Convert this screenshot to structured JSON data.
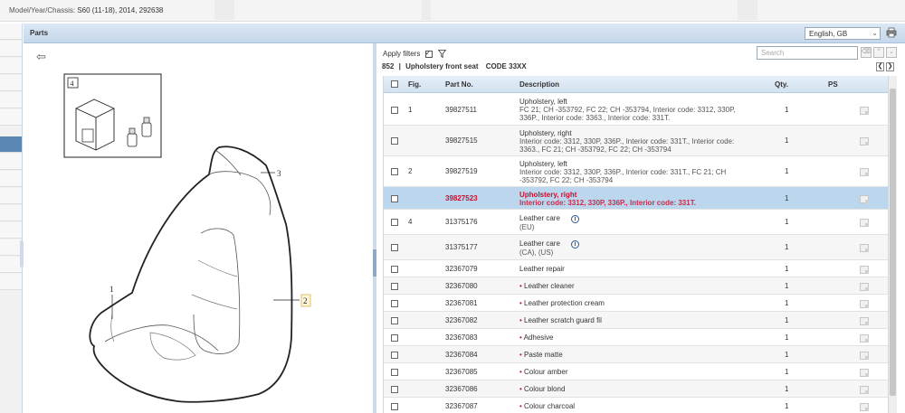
{
  "topbar": {
    "model_label": "Model/Year/Chassis:",
    "model_value": "S60 (11-18), 2014, 292638"
  },
  "parts_panel": {
    "title": "Parts",
    "language": "English, GB",
    "search_placeholder": "Search"
  },
  "toolbar": {
    "apply_filters_label": "Apply filters",
    "apply_filters_checked": true,
    "section_number": "852",
    "separator": "|",
    "section_title": "Upholstery front seat",
    "section_code": "CODE 33XX"
  },
  "illustration": {
    "inset_label": "4",
    "callouts": [
      "1",
      "2",
      "3"
    ]
  },
  "table": {
    "headers": {
      "fig": "Fig.",
      "part_no": "Part No.",
      "description": "Description",
      "qty": "Qty.",
      "ps": "PS"
    },
    "rows": [
      {
        "fig": "1",
        "part_no": "39827511",
        "title": "Upholstery, left",
        "details": [
          "FC 21; CH -353792, FC 22; CH -353794, Interior code: 3312, 330P,",
          "336P., Interior code: 3363., Interior code: 331T."
        ],
        "qty": "1"
      },
      {
        "fig": "",
        "part_no": "39827515",
        "title": "Upholstery, right",
        "details": [
          "Interior code: 3312, 330P, 336P., Interior code: 331T., Interior code:",
          "3363., FC 21; CH -353792, FC 22; CH -353794"
        ],
        "qty": "1"
      },
      {
        "fig": "2",
        "part_no": "39827519",
        "title": "Upholstery, left",
        "details": [
          "Interior code: 3312, 330P, 336P., Interior code: 331T., FC 21; CH",
          "-353792, FC 22; CH -353794"
        ],
        "qty": "1"
      },
      {
        "fig": "",
        "part_no": "39827523",
        "title": "Upholstery, right",
        "details": [
          "Interior code: 3312, 330P, 336P., Interior code: 331T."
        ],
        "qty": "1",
        "selected": true
      },
      {
        "fig": "4",
        "part_no": "31375176",
        "title": "Leather care",
        "details": [
          "(EU)"
        ],
        "qty": "1",
        "info": true
      },
      {
        "fig": "",
        "part_no": "31375177",
        "title": "Leather care",
        "details": [
          "(CA), (US)"
        ],
        "qty": "1",
        "info": true
      },
      {
        "fig": "",
        "part_no": "32367079",
        "title": "Leather repair",
        "details": [],
        "qty": "1"
      },
      {
        "fig": "",
        "part_no": "32367080",
        "title": "Leather cleaner",
        "details": [],
        "qty": "1",
        "bullet": true
      },
      {
        "fig": "",
        "part_no": "32367081",
        "title": "Leather protection cream",
        "details": [],
        "qty": "1",
        "bullet": true
      },
      {
        "fig": "",
        "part_no": "32367082",
        "title": "Leather scratch guard fil",
        "details": [],
        "qty": "1",
        "bullet": true
      },
      {
        "fig": "",
        "part_no": "32367083",
        "title": "Adhesive",
        "details": [],
        "qty": "1",
        "bullet": true
      },
      {
        "fig": "",
        "part_no": "32367084",
        "title": "Paste matte",
        "details": [],
        "qty": "1",
        "bullet": true
      },
      {
        "fig": "",
        "part_no": "32367085",
        "title": "Colour amber",
        "details": [],
        "qty": "1",
        "bullet": true
      },
      {
        "fig": "",
        "part_no": "32367086",
        "title": "Colour blond",
        "details": [],
        "qty": "1",
        "bullet": true
      },
      {
        "fig": "",
        "part_no": "32367087",
        "title": "Colour charcoal",
        "details": [],
        "qty": "1",
        "bullet": true
      }
    ]
  },
  "colors": {
    "header_blue": "#c5d8ec",
    "selected_row": "#bcd6ee",
    "selected_text": "#c8102e",
    "nav_active": "#5b87b5"
  }
}
